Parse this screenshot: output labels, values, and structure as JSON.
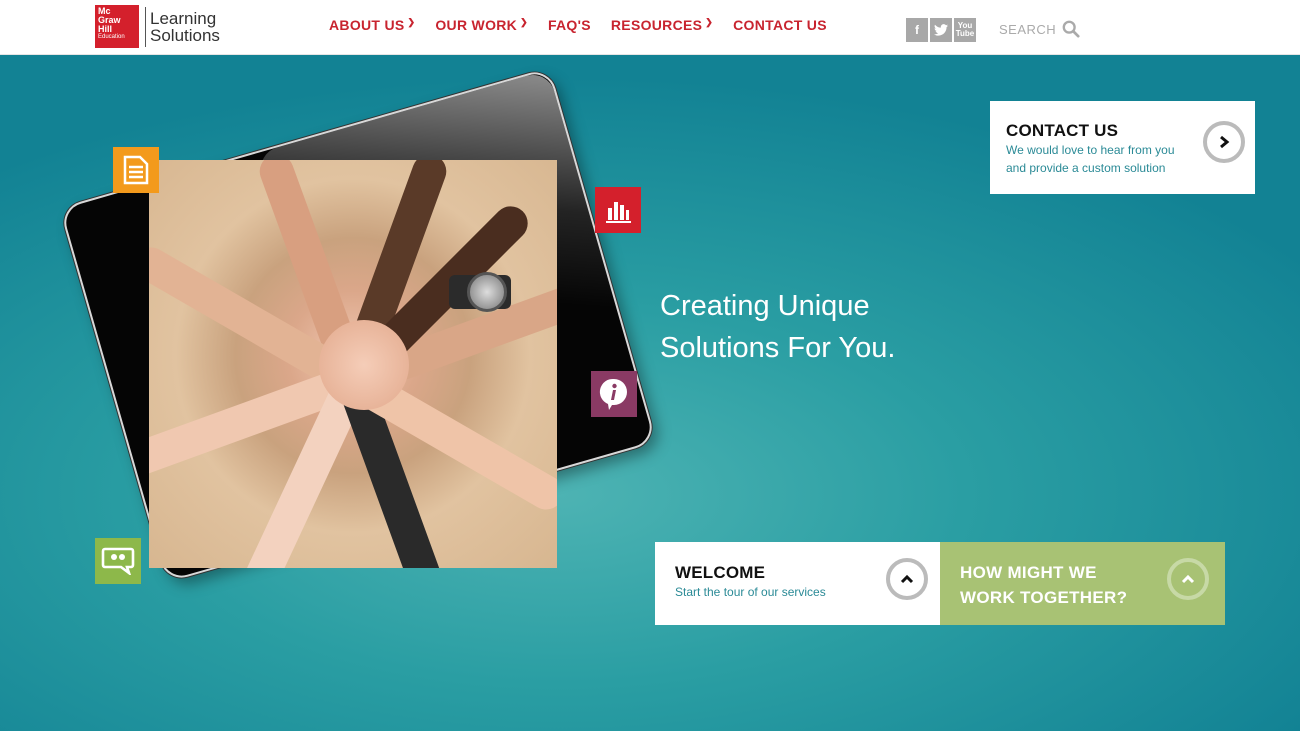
{
  "brand": {
    "logo_line1": "Mc",
    "logo_line2": "Graw",
    "logo_line3": "Hill",
    "logo_line4": "Education",
    "name_line1": "Learning",
    "name_line2": "Solutions",
    "red": "#d4202c"
  },
  "nav": {
    "items": [
      {
        "label": "ABOUT US",
        "dropdown": true
      },
      {
        "label": "OUR WORK",
        "dropdown": true
      },
      {
        "label": "FAQ'S",
        "dropdown": false
      },
      {
        "label": "RESOURCES",
        "dropdown": true
      },
      {
        "label": "CONTACT US",
        "dropdown": false
      }
    ],
    "color": "#c8242f"
  },
  "social": {
    "facebook": "f",
    "youtube_line1": "You",
    "youtube_line2": "Tube"
  },
  "search": {
    "label": "SEARCH"
  },
  "hero": {
    "headline_line1": "Creating Unique",
    "headline_line2": "Solutions For You.",
    "background": "#2a9ea3"
  },
  "contact_card": {
    "title": "CONTACT US",
    "text_line1": "We would love to hear from you",
    "text_line2": "and provide a custom solution"
  },
  "welcome_card": {
    "title": "WELCOME",
    "text": "Start the tour of our services"
  },
  "together_card": {
    "title_line1": "HOW MIGHT WE",
    "title_line2": "WORK TOGETHER?",
    "background": "#a8c274"
  },
  "feature_icons": {
    "document": "document-icon",
    "chart": "bar-chart-icon",
    "info": "info-icon",
    "quote": "speech-bubble-icon",
    "colors": {
      "document": "#f39a1c",
      "chart": "#d4202c",
      "info": "#8a3a64",
      "quote": "#8db84a"
    }
  }
}
